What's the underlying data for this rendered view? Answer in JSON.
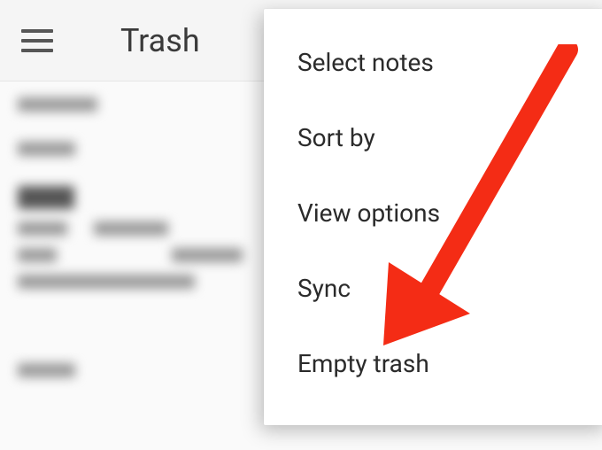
{
  "header": {
    "title": "Trash"
  },
  "menu": {
    "items": [
      "Select notes",
      "Sort by",
      "View options",
      "Sync",
      "Empty trash"
    ]
  }
}
